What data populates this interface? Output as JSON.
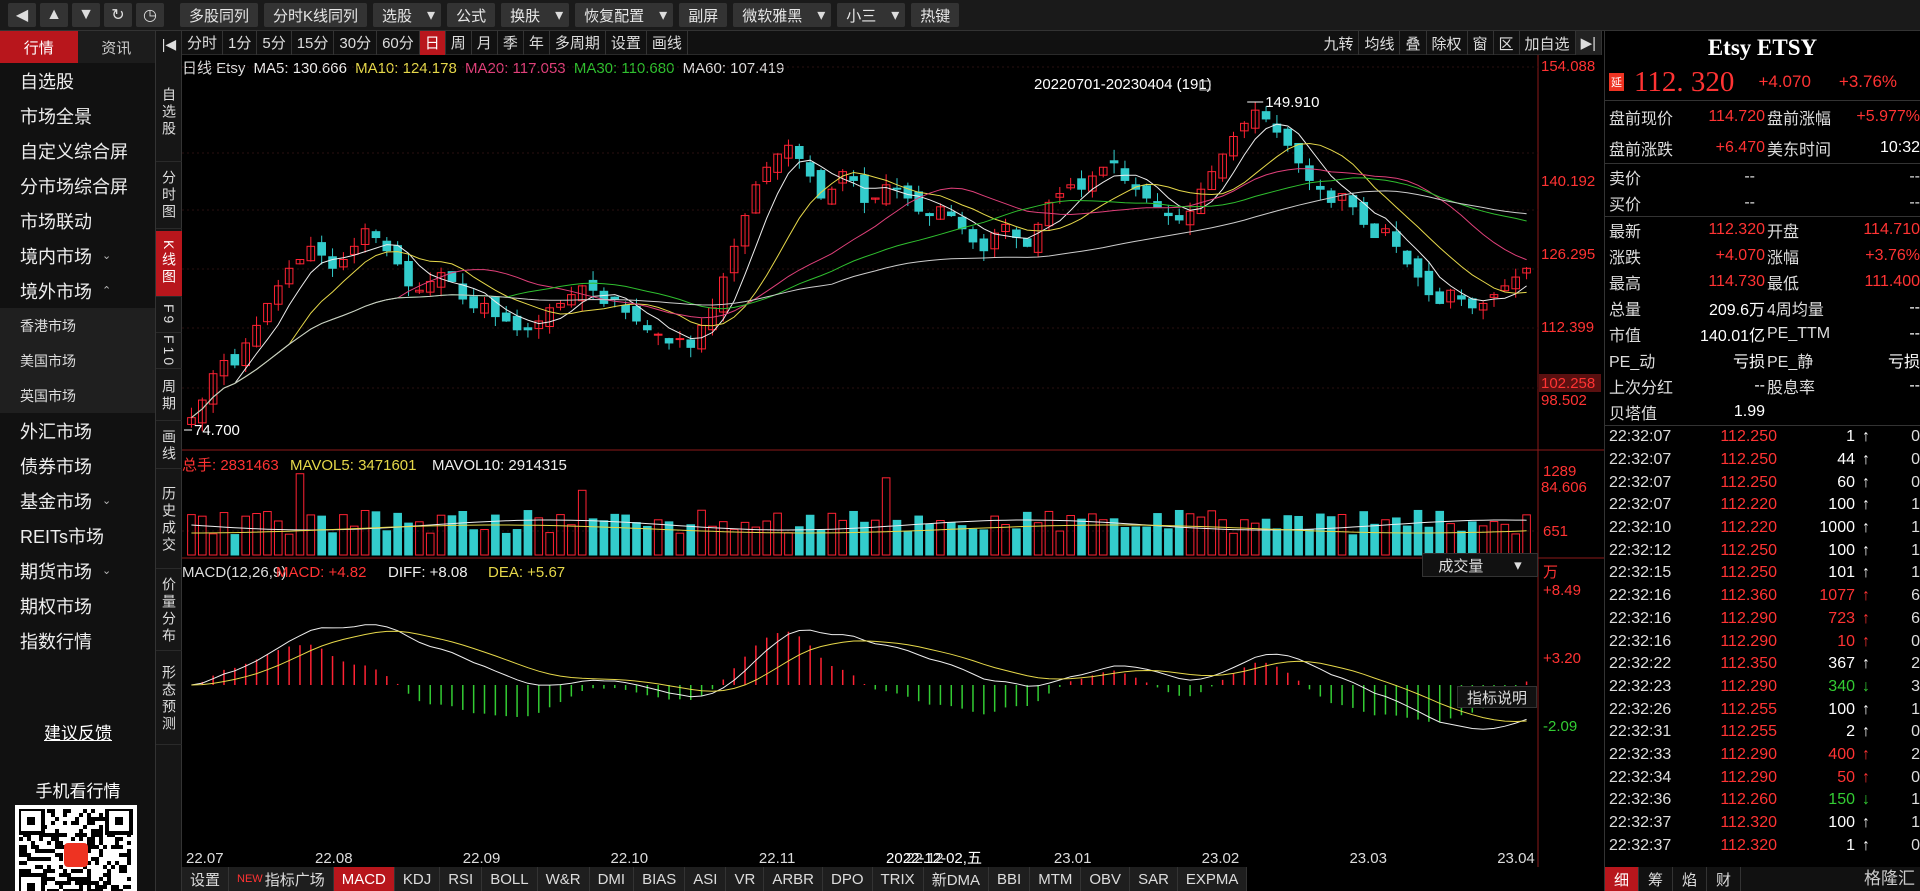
{
  "toolbar": {
    "buttons": [
      "多股同列",
      "分时K线同列",
      "选股",
      "公式",
      "换肤",
      "恢复配置",
      "副屏",
      "微软雅黑",
      "小三",
      "热键"
    ],
    "dropdowns": [
      false,
      false,
      true,
      false,
      true,
      true,
      false,
      true,
      true,
      false
    ]
  },
  "left_nav": {
    "tabs": [
      "行情",
      "资讯"
    ],
    "items": [
      {
        "label": "自选股"
      },
      {
        "label": "市场全景"
      },
      {
        "label": "自定义综合屏"
      },
      {
        "label": "分市场综合屏"
      },
      {
        "label": "市场联动"
      },
      {
        "label": "境内市场",
        "chev": "⌄"
      },
      {
        "label": "境外市场",
        "chev": "⌃"
      }
    ],
    "subitems": [
      "香港市场",
      "美国市场",
      "英国市场"
    ],
    "items2": [
      {
        "label": "外汇市场"
      },
      {
        "label": "债券市场"
      },
      {
        "label": "基金市场",
        "chev": "⌄"
      },
      {
        "label": "REITs市场"
      },
      {
        "label": "期货市场",
        "chev": "⌄"
      },
      {
        "label": "期权市场"
      },
      {
        "label": "指数行情"
      }
    ],
    "feedback": "建议反馈",
    "mobile": "手机看行情"
  },
  "vtabs": [
    "自选股",
    "分时图",
    "K线图",
    "F9",
    "F10",
    "周期",
    "画线",
    "历史成交",
    "价量分布",
    "形态预测"
  ],
  "period_bar": {
    "items": [
      "分时",
      "1分",
      "5分",
      "15分",
      "30分",
      "60分",
      "日",
      "周",
      "月",
      "季",
      "年",
      "多周期",
      "设置",
      "画线"
    ],
    "active": "日",
    "right": [
      "九转",
      "均线",
      "叠",
      "除权",
      "窗",
      "区",
      "加自选"
    ]
  },
  "ma_line": {
    "prefix": "日线  Etsy",
    "ma5": "MA5: 130.666",
    "ma10": "MA10: 124.178",
    "ma20": "MA20: 117.053",
    "ma30": "MA30: 110.680",
    "ma60": "MA60: 107.419"
  },
  "chart_data": {
    "type": "candlestick",
    "symbol": "Etsy",
    "range_label": "20220701-20230404 (191)",
    "high_label": "149.910",
    "low_label": "74.700",
    "price_ticks": [
      "154.088",
      "140.192",
      "126.295",
      "112.399",
      "98.502",
      "84.606"
    ],
    "current_tag": "102.258",
    "price_range": [
      72,
      156
    ],
    "x_labels": [
      "22.07",
      "22.08",
      "22.09",
      "22.10",
      "22.11",
      "22.12",
      "23.01",
      "23.02",
      "23.03",
      "23.04"
    ],
    "crosshair_label": "2022-12-02,五",
    "close_series": [
      78,
      82,
      88,
      91,
      90,
      95,
      99,
      104,
      108,
      112,
      114,
      117,
      115,
      112,
      114,
      117,
      121,
      119,
      116,
      113,
      108,
      107,
      109,
      111,
      109,
      105,
      103,
      104,
      101,
      100,
      98,
      98,
      100,
      103,
      104,
      106,
      108,
      107,
      104,
      105,
      102,
      100,
      98,
      97,
      95,
      96,
      94,
      99,
      103,
      110,
      117,
      124,
      131,
      135,
      138,
      140,
      137,
      133,
      128,
      130,
      134,
      132,
      127,
      128,
      131,
      130,
      128,
      125,
      124,
      126,
      124,
      121,
      118,
      116,
      120,
      122,
      119,
      117,
      122,
      127,
      129,
      131,
      130,
      133,
      135,
      136,
      132,
      130,
      128,
      126,
      124,
      123,
      125,
      130,
      134,
      138,
      142,
      145,
      148,
      146,
      143,
      140,
      136,
      132,
      130,
      127,
      129,
      126,
      122,
      119,
      121,
      117,
      113,
      110,
      106,
      104,
      107,
      105,
      103,
      104,
      106,
      108,
      110,
      112
    ],
    "volume": {
      "label": "总手: 2831463",
      "mavol5": "MAVOL5: 3471601",
      "mavol10": "MAVOL10: 2914315",
      "ticks": [
        "1289",
        "651"
      ],
      "unit": "万",
      "select": "成交量"
    },
    "macd": {
      "label": "MACD(12,26,9)",
      "macd": "MACD: +4.82",
      "diff": "DIFF: +8.08",
      "dea": "DEA: +5.67",
      "ticks": [
        "+8.49",
        "+3.20",
        "-2.09"
      ],
      "explain": "指标说明"
    }
  },
  "indicator_bar": {
    "items": [
      "设置",
      "指标广场",
      "MACD",
      "KDJ",
      "RSI",
      "BOLL",
      "W&R",
      "DMI",
      "BIAS",
      "ASI",
      "VR",
      "ARBR",
      "DPO",
      "TRIX",
      "新DMA",
      "BBI",
      "MTM",
      "OBV",
      "SAR",
      "EXPMA"
    ],
    "active": "MACD",
    "new_on": "指标广场",
    "new_label": "NEW"
  },
  "quote": {
    "title": "Etsy ETSY",
    "badge": "延",
    "price": "112. 320",
    "change": "+4.070",
    "pct": "+3.76%",
    "pre": [
      {
        "k": "盘前现价",
        "v": "114.720",
        "k2": "盘前涨幅",
        "v2": "+5.977%"
      },
      {
        "k": "盘前涨跌",
        "v": "+6.470",
        "k2": "美东时间",
        "v2": "10:32"
      }
    ],
    "bidask": [
      {
        "k": "卖价",
        "v": "--",
        "v2": "--"
      },
      {
        "k": "买价",
        "v": "--",
        "v2": "--"
      }
    ],
    "stats": [
      {
        "k": "最新",
        "v": "112.320",
        "vc": "red",
        "k2": "开盘",
        "v2": "114.710",
        "v2c": "red"
      },
      {
        "k": "涨跌",
        "v": "+4.070",
        "vc": "red",
        "k2": "涨幅",
        "v2": "+3.76%",
        "v2c": "red"
      },
      {
        "k": "最高",
        "v": "114.730",
        "vc": "red",
        "k2": "最低",
        "v2": "111.400",
        "v2c": "red"
      },
      {
        "k": "总量",
        "v": "209.6万",
        "vc": "white",
        "k2": "4周均量",
        "v2": "--",
        "v2c": "white"
      },
      {
        "k": "市值",
        "v": "140.01亿",
        "vc": "white",
        "k2": "PE_TTM",
        "v2": "--",
        "v2c": "white"
      },
      {
        "k": "PE_动",
        "v": "亏损",
        "vc": "white",
        "k2": "PE_静",
        "v2": "亏损",
        "v2c": "white"
      },
      {
        "k": "上次分红",
        "v": "--",
        "vc": "white",
        "k2": "股息率",
        "v2": "--",
        "v2c": "white"
      },
      {
        "k": "贝塔值",
        "v": "1.99",
        "vc": "white",
        "k2": "",
        "v2": "",
        "v2c": "white"
      }
    ],
    "ticks": [
      [
        "22:32:07",
        "112.250",
        "1",
        "up",
        "0"
      ],
      [
        "22:32:07",
        "112.250",
        "44",
        "up",
        "0"
      ],
      [
        "22:32:07",
        "112.250",
        "60",
        "up",
        "0"
      ],
      [
        "22:32:07",
        "112.220",
        "100",
        "up",
        "1"
      ],
      [
        "22:32:10",
        "112.220",
        "1000",
        "up",
        "1"
      ],
      [
        "22:32:12",
        "112.250",
        "100",
        "up",
        "1"
      ],
      [
        "22:32:15",
        "112.250",
        "101",
        "up",
        "1"
      ],
      [
        "22:32:16",
        "112.360",
        "1077",
        "upr",
        "6"
      ],
      [
        "22:32:16",
        "112.290",
        "723",
        "upr",
        "6"
      ],
      [
        "22:32:16",
        "112.290",
        "10",
        "upr",
        "0"
      ],
      [
        "22:32:22",
        "112.350",
        "367",
        "up",
        "2"
      ],
      [
        "22:32:23",
        "112.290",
        "340",
        "down",
        "3"
      ],
      [
        "22:32:26",
        "112.255",
        "100",
        "up",
        "1"
      ],
      [
        "22:32:31",
        "112.255",
        "2",
        "up",
        "0"
      ],
      [
        "22:32:33",
        "112.290",
        "400",
        "upr",
        "2"
      ],
      [
        "22:32:34",
        "112.290",
        "50",
        "upr",
        "0"
      ],
      [
        "22:32:36",
        "112.260",
        "150",
        "down",
        "1"
      ],
      [
        "22:32:37",
        "112.320",
        "100",
        "up",
        "1"
      ],
      [
        "22:32:37",
        "112.320",
        "1",
        "up",
        "0"
      ]
    ],
    "bottom_tabs": [
      "细",
      "筹",
      "焰",
      "财"
    ],
    "logo": "格隆汇"
  }
}
